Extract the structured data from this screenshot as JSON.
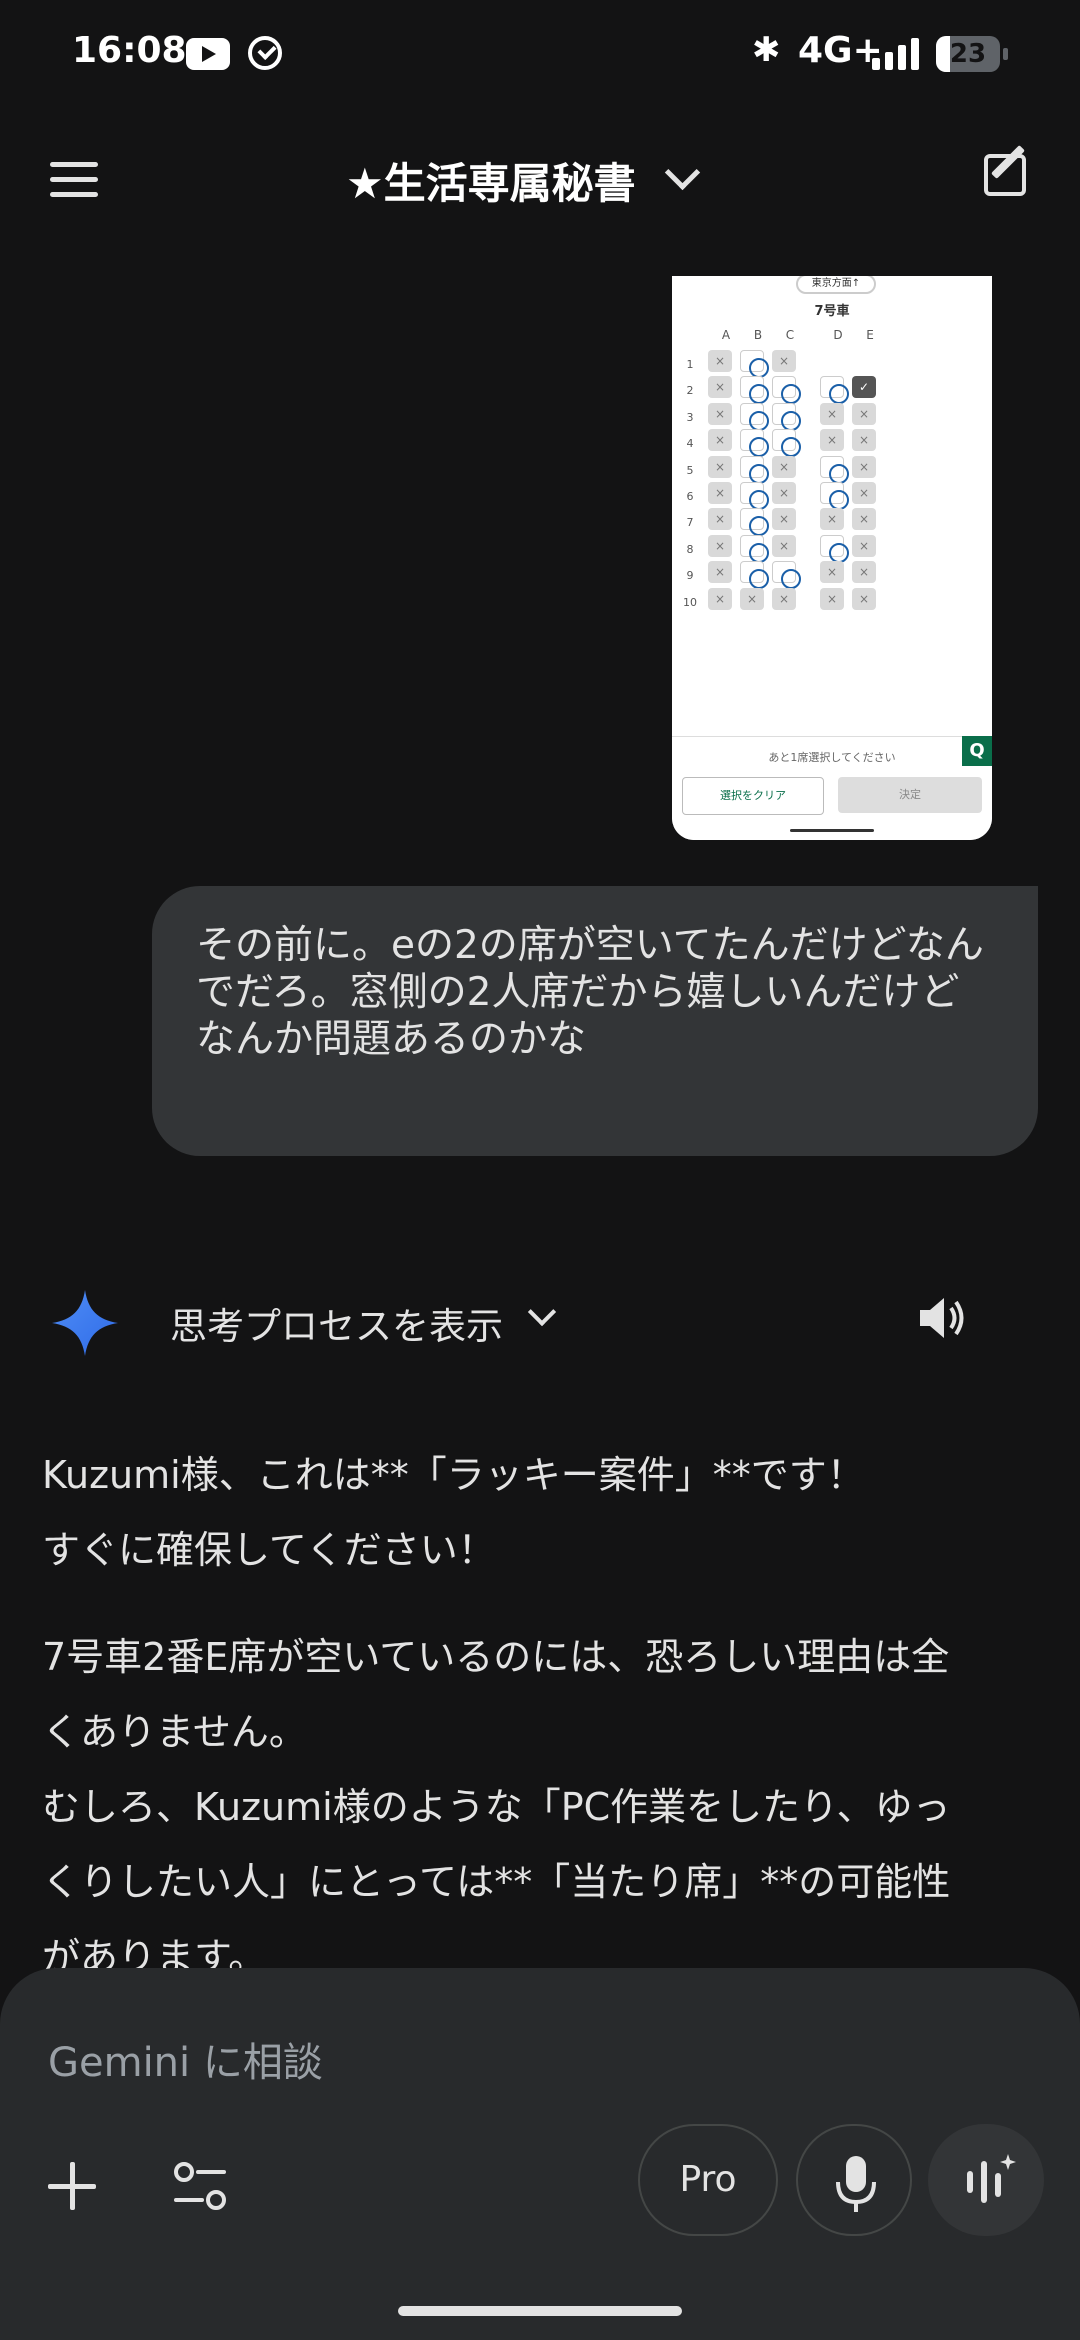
{
  "status_bar": {
    "time": "16:08",
    "network": "4G+",
    "battery": "23",
    "icons": [
      "youtube-icon",
      "check-circle-icon",
      "bluetooth-icon",
      "signal-icon",
      "battery-icon"
    ]
  },
  "header": {
    "title": "★生活専属秘書",
    "icons": [
      "menu-icon",
      "chevron-down-icon",
      "edit-icon"
    ]
  },
  "seat_map": {
    "destination": "東京方面↑",
    "car": "7号車",
    "columns": [
      "A",
      "B",
      "C",
      "D",
      "E"
    ],
    "rows": [
      "1",
      "2",
      "3",
      "4",
      "5",
      "6",
      "7",
      "8",
      "9",
      "10"
    ],
    "seats": [
      [
        "x",
        "o",
        "x",
        "",
        ""
      ],
      [
        "x",
        "o",
        "o",
        "o",
        "sel"
      ],
      [
        "x",
        "o",
        "o",
        "x",
        "x"
      ],
      [
        "x",
        "o",
        "o",
        "x",
        "x"
      ],
      [
        "x",
        "o",
        "x",
        "o",
        "x"
      ],
      [
        "x",
        "o",
        "x",
        "o",
        "x"
      ],
      [
        "x",
        "o",
        "x",
        "x",
        "x"
      ],
      [
        "x",
        "o",
        "x",
        "o",
        "x"
      ],
      [
        "x",
        "o",
        "o",
        "x",
        "x"
      ],
      [
        "x",
        "x",
        "x",
        "x",
        "x"
      ]
    ],
    "remaining_text": "あと1席選択してください",
    "clear_button": "選択をクリア",
    "confirm_button": "決定",
    "q_button": "Q"
  },
  "user_message": {
    "text": "その前に。eの2の席が空いてたんだけどなんでだろ。窓側の2人席だから嬉しいんだけどなんか問題あるのかな"
  },
  "assistant": {
    "thinking_label": "思考プロセスを表示",
    "paragraph1_line1": "Kuzumi様、これは**「ラッキー案件」**です！",
    "paragraph1_line2": "すぐに確保してください！",
    "paragraph2_line1": "7号車2番E席が空いているのには、恐ろしい理由は全",
    "paragraph2_line2": "くありません。",
    "paragraph2_line3": "むしろ、Kuzumi様のような「PC作業をしたり、ゆっ",
    "paragraph2_line4": "くりしたい人」にとっては**「当たり席」**の可能性",
    "paragraph2_line5": "があります。"
  },
  "composer": {
    "placeholder": "Gemini に相談",
    "pro_label": "Pro",
    "icons": [
      "plus-icon",
      "tools-icon",
      "mic-icon",
      "live-icon"
    ]
  },
  "colors": {
    "background": "#131314",
    "bubble": "#333537",
    "composer": "#282a2c",
    "spark_blue": "#4285f4"
  }
}
